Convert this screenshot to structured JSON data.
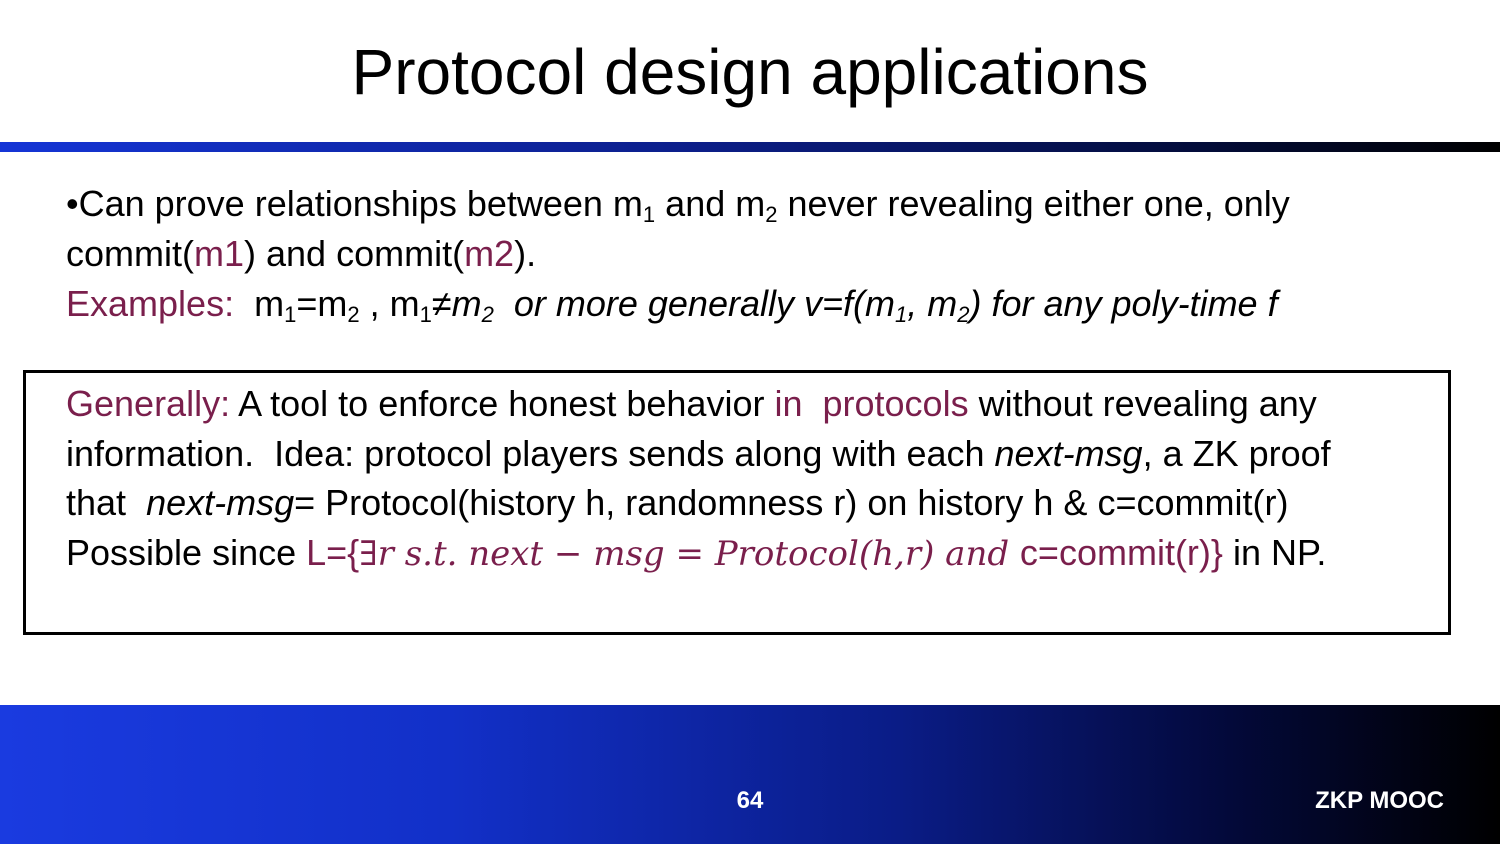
{
  "slide": {
    "title": "Protocol design applications",
    "bullet": {
      "marker": "•",
      "text_a": "Can prove relationships between m",
      "sub_1": "1",
      "text_b": " and m",
      "sub_2": "2",
      "text_c": " never revealing either one, only",
      "line2_a": "commit(",
      "line2_m1": "m1",
      "line2_b": ") and commit(",
      "line2_m2": "m2",
      "line2_c": ")."
    },
    "examples": {
      "label": "Examples:",
      "e1_m": "  m",
      "e1_s1": "1",
      "e1_eq": "=m",
      "e1_s2": "2",
      "e1_sep": " , m",
      "e2_s1": "1",
      "e2_neq": "≠m",
      "e2_s2": "2",
      "rest_a": "  or more generally v=f(m",
      "rest_s1": "1",
      "rest_b": ", m",
      "rest_s2": "2",
      "rest_c": ") for any poly-time f"
    },
    "box": {
      "label": "Generally:",
      "l1_a": " A tool to enforce honest behavior ",
      "l1_hl": "in  protocols",
      "l1_b": " without revealing any",
      "l2_a": "information.  Idea: protocol players sends along with each ",
      "l2_it": "next-msg",
      "l2_b": ", a ZK proof",
      "l3_a": "that  ",
      "l3_it": "next-msg",
      "l3_b": "= Protocol(history h, randomness r) on history h & c=commit(r)",
      "l4_a": "Possible since ",
      "l4_lang": "L={",
      "l4_math": "∃r s.t. next − msg = Protocol(h,r) and ",
      "l4_commit": "c=commit(r)}",
      "l4_b": " in NP."
    }
  },
  "footer": {
    "page_number": "64",
    "brand": "ZKP MOOC"
  },
  "colors": {
    "accent": "#7a1f4c",
    "footer_blue": "#1a3be0",
    "rule_blue": "#1535d6"
  }
}
